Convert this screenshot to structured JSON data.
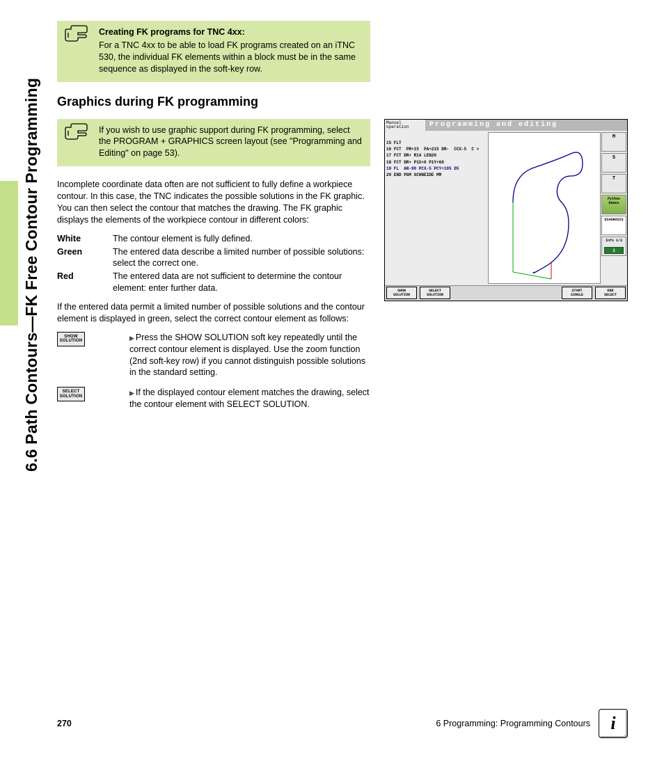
{
  "side_heading": "6.6 Path Contours—FK Free Contour Programming",
  "note1": {
    "title": "Creating FK programs for TNC 4xx:",
    "body": "For a TNC 4xx to be able to load FK programs created on an iTNC 530, the individual FK elements within a block must be in the same sequence as displayed in the soft-key row."
  },
  "section_heading": "Graphics during FK programming",
  "note2": {
    "body": "If you wish to use graphic support during FK programming, select the PROGRAM + GRAPHICS screen layout (see \"Programming and Editing\" on page 53)."
  },
  "para1": "Incomplete coordinate data often are not sufficient to fully define a workpiece contour. In this case, the TNC indicates the possible solutions in the FK graphic. You can then select the contour that matches the drawing. The FK graphic displays the elements of the workpiece contour in different colors:",
  "defs": [
    {
      "term": "White",
      "def": "The contour element is fully defined."
    },
    {
      "term": "Green",
      "def": "The entered data describe a limited number of possible solutions: select the correct one."
    },
    {
      "term": "Red",
      "def": "The entered data are not sufficient to determine the contour element: enter further data."
    }
  ],
  "para2": "If the entered data permit a limited number of possible solutions and the contour element is displayed in green, select the correct contour element as follows:",
  "steps": [
    {
      "key_l1": "SHOW",
      "key_l2": "SOLUTION",
      "txt": "Press the SHOW SOLUTION soft key repeatedly until the correct contour element is displayed. Use the zoom function (2nd soft-key row) if you cannot distinguish possible solutions in the standard setting."
    },
    {
      "key_l1": "SELECT",
      "key_l2": "SOLUTION",
      "txt": "If the displayed contour element matches the drawing, select the contour element with SELECT SOLUTION."
    }
  ],
  "screenshot": {
    "mode_l1": "Manual",
    "mode_l2": "operation",
    "title": "Programming and editing",
    "code": [
      {
        "t": "15 FLT"
      },
      {
        "t": "16 FCT  PR+15  PA+215 DR-  CCX-5  C >"
      },
      {
        "t": "17 FCT DR+ R14 LEN20"
      },
      {
        "t": "18 FCT DR+ P1X+0 P1Y+60"
      },
      {
        "t": "19 FL  AN-90 PCX-5 PCY+105 D5",
        "blue": true
      },
      {
        "t": "20 END PGM SCHNEIDE MM"
      }
    ],
    "right_icons": {
      "m": "M",
      "s": "S",
      "t": "T",
      "python": "Python",
      "demos": "Demos",
      "diagnosis": "DIAGNOSIS",
      "info": "Info 1/3"
    },
    "softkeys": {
      "sk1_l1": "SHOW",
      "sk1_l2": "SOLUTION",
      "sk2_l1": "SELECT",
      "sk2_l2": "SOLUTION",
      "sk3_l1": "START",
      "sk3_l2": "SINGLE",
      "sk4_l1": "END",
      "sk4_l2": "SELECT"
    }
  },
  "footer": {
    "page": "270",
    "chapter": "6 Programming: Programming Contours"
  }
}
